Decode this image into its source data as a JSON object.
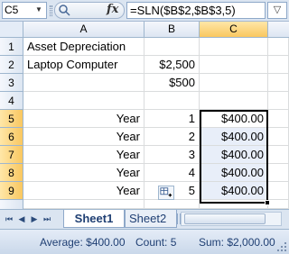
{
  "formula_bar": {
    "name_box": "C5",
    "name_box_dropdown": "▼",
    "fx_label": "fx",
    "formula": "=SLN($B$2,$B$3,5)",
    "expand_glyph": "▽"
  },
  "grid": {
    "columns": [
      "A",
      "B",
      "C"
    ],
    "rows": [
      "1",
      "2",
      "3",
      "4",
      "5",
      "6",
      "7",
      "8",
      "9"
    ],
    "cells": {
      "A1": "Asset Depreciation",
      "A2": "Laptop Computer",
      "B2": "$2,500",
      "B3": "$500",
      "A5": "Year",
      "B5": "1",
      "C5": "$400.00",
      "A6": "Year",
      "B6": "2",
      "C6": "$400.00",
      "A7": "Year",
      "B7": "3",
      "C7": "$400.00",
      "A8": "Year",
      "B8": "4",
      "C8": "$400.00",
      "A9": "Year",
      "B9": "5",
      "C9": "$400.00"
    },
    "selected_range": "C5:C9"
  },
  "sheet_tabs": {
    "tabs": [
      "Sheet1",
      "Sheet2"
    ],
    "active": "Sheet1",
    "nav": [
      "⏮",
      "◀",
      "▶",
      "⏭"
    ]
  },
  "status_bar": {
    "average": "Average: $400.00",
    "count": "Count: 5",
    "sum": "Sum: $2,000.00"
  },
  "colors": {
    "header_bg": "#dde6f2",
    "selected_header": "#f9c760",
    "selection_fill": "#e8eef9",
    "tab_text": "#1f3f73"
  }
}
